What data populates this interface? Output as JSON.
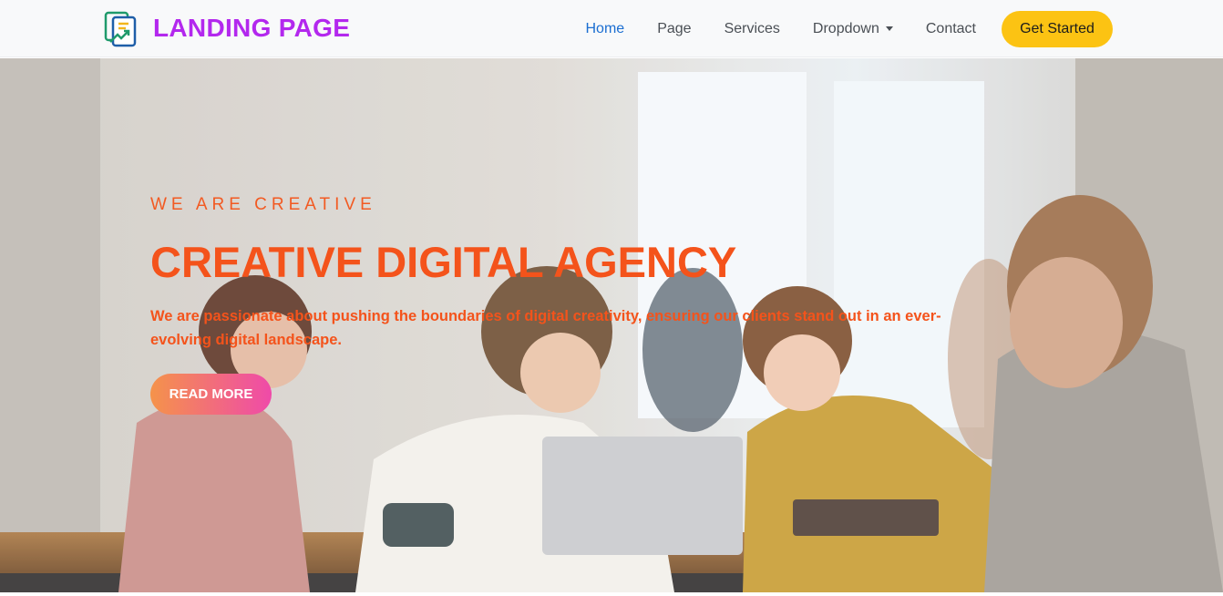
{
  "navbar": {
    "brand": "LANDING PAGE",
    "items": [
      {
        "label": "Home",
        "active": true
      },
      {
        "label": "Page"
      },
      {
        "label": "Services"
      },
      {
        "label": "Dropdown",
        "has_caret": true
      },
      {
        "label": "Contact"
      }
    ],
    "cta_label": "Get Started"
  },
  "hero": {
    "eyebrow": "WE ARE CREATIVE",
    "headline": "CREATIVE DIGITAL AGENCY",
    "lead": "We are passionate about pushing the boundaries of digital creativity, ensuring our clients stand out in an ever-evolving digital landscape.",
    "button_label": "READ MORE"
  },
  "colors": {
    "brand": "#b328ee",
    "active_nav": "#1b6ed1",
    "cta": "#fcc313",
    "hero_text": "#f4531b",
    "button_gradient_start": "#f5934a",
    "button_gradient_end": "#ef4aa9"
  }
}
